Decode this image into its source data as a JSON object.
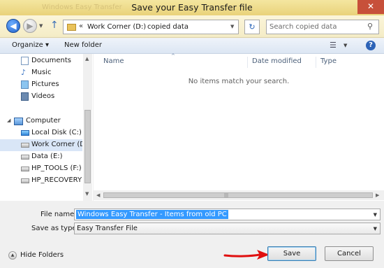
{
  "window": {
    "title": "Save your Easy Transfer file",
    "ghost_title": "Windows Easy Transfer",
    "close_glyph": "✕"
  },
  "nav": {
    "back_glyph": "◀",
    "forward_glyph": "▶",
    "up_glyph": "↑",
    "refresh_glyph": "↻",
    "breadcrumbs": [
      "Work Corner (D:)",
      "copied data"
    ],
    "search_placeholder": "Search copied data",
    "search_glyph": "⚲"
  },
  "toolbar": {
    "organize_label": "Organize ▾",
    "new_folder_label": "New folder",
    "views_glyph": "☰",
    "help_glyph": "?"
  },
  "sidebar": {
    "libraries": [
      {
        "label": "Documents",
        "icon": "document-icon"
      },
      {
        "label": "Music",
        "icon": "music-icon"
      },
      {
        "label": "Pictures",
        "icon": "pictures-icon"
      },
      {
        "label": "Videos",
        "icon": "videos-icon"
      }
    ],
    "computer_label": "Computer",
    "drives": [
      {
        "label": "Local Disk (C:)",
        "icon": "windows-drive-icon",
        "selected": false
      },
      {
        "label": "Work Corner (D:)",
        "icon": "drive-icon",
        "selected": true
      },
      {
        "label": "Data (E:)",
        "icon": "drive-icon",
        "selected": false
      },
      {
        "label": "HP_TOOLS (F:)",
        "icon": "drive-icon",
        "selected": false
      },
      {
        "label": "HP_RECOVERY (H",
        "icon": "drive-icon",
        "selected": false
      }
    ]
  },
  "filelist": {
    "columns": [
      "Name",
      "Date modified",
      "Type"
    ],
    "empty_message": "No items match your search."
  },
  "form": {
    "file_name_label": "File name:",
    "file_name_value": "Windows Easy Transfer - Items from old PC",
    "save_as_type_label": "Save as type:",
    "save_as_type_value": "Easy Transfer File"
  },
  "footer": {
    "hide_folders_label": "Hide Folders",
    "save_label": "Save",
    "cancel_label": "Cancel"
  },
  "colors": {
    "title_bar": "#f4e6a0",
    "close_button": "#c7503a",
    "selection": "#3399ff",
    "annotation_arrow": "#e01010"
  }
}
